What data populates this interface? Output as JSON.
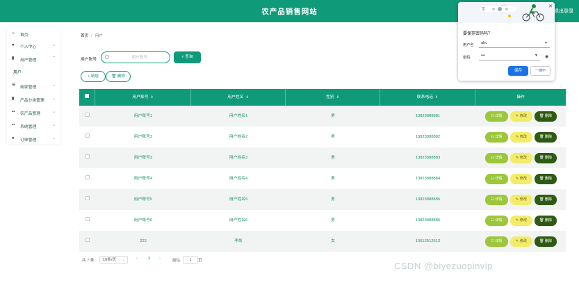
{
  "header": {
    "title": "农产品销售网站",
    "logout": "退出登录"
  },
  "sidebar": {
    "items": [
      {
        "label": "首页",
        "icon": "home-icon",
        "has_children": false
      },
      {
        "label": "个人中心",
        "icon": "user-icon",
        "has_children": true
      },
      {
        "label": "用户管理",
        "icon": "file-icon",
        "has_children": true
      },
      {
        "label": "商家管理",
        "icon": "menu-icon",
        "has_children": true
      },
      {
        "label": "产品分类管理",
        "icon": "file-icon",
        "has_children": true
      },
      {
        "label": "农产品管理",
        "icon": "grid-icon",
        "has_children": true
      },
      {
        "label": "系统管理",
        "icon": "grid-icon",
        "has_children": true
      },
      {
        "label": "订单管理",
        "icon": "user-icon",
        "has_children": true
      }
    ],
    "sub_item": "用户"
  },
  "breadcrumb": {
    "home": "首页",
    "separator": "/",
    "current": "用户"
  },
  "search": {
    "label": "用户账号",
    "placeholder": "用户账号",
    "value": "",
    "button": "查询"
  },
  "actions": {
    "add": "新增",
    "delete": "删除"
  },
  "table": {
    "columns": [
      "用户账号",
      "用户姓名",
      "性别",
      "联系电话",
      "操作"
    ],
    "rows": [
      {
        "account": "用户账号1",
        "name": "用户姓名1",
        "gender": "男",
        "phone": "13823888881"
      },
      {
        "account": "用户账号2",
        "name": "用户姓名2",
        "gender": "男",
        "phone": "13823888882"
      },
      {
        "account": "用户账号3",
        "name": "用户姓名3",
        "gender": "男",
        "phone": "13823888883"
      },
      {
        "account": "用户账号4",
        "name": "用户姓名4",
        "gender": "男",
        "phone": "13823888884"
      },
      {
        "account": "用户账号5",
        "name": "用户姓名5",
        "gender": "男",
        "phone": "13823888885"
      },
      {
        "account": "用户账号6",
        "name": "用户姓名6",
        "gender": "男",
        "phone": "13823888886"
      },
      {
        "account": "222",
        "name": "李凯",
        "gender": "女",
        "phone": "13612512512"
      }
    ],
    "row_actions": {
      "detail": "详情",
      "edit": "修改",
      "delete": "删除"
    }
  },
  "pagination": {
    "total": "共 7 条",
    "page_size": "10条/页",
    "current_page": "1",
    "goto_prefix": "前往",
    "goto_value": "1",
    "goto_suffix": "页"
  },
  "password_prompt": {
    "title": "要保存密码吗？",
    "username_label": "用户名",
    "username_value": "abc",
    "password_label": "密码",
    "password_value": "•••",
    "save": "保存",
    "never": "一律不"
  },
  "watermark": "CSDN @biyezuopinvip",
  "colors": {
    "primary": "#0f9a79",
    "detail": "#9cc63c",
    "edit": "#f3ec69",
    "delete": "#2e5b13",
    "save_blue": "#1a73e8"
  }
}
